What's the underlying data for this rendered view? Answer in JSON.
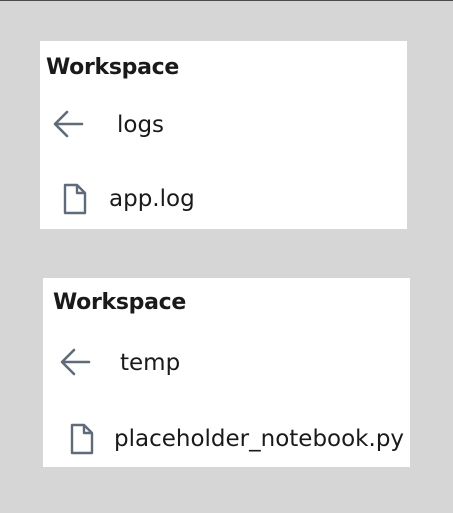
{
  "colors": {
    "background": "#d6d6d6",
    "panel": "#ffffff",
    "text": "#1a1a1a",
    "icon": "#5f6b78"
  },
  "panels": [
    {
      "title": "Workspace",
      "back_icon": "arrow-left-icon",
      "folder": "logs",
      "files": [
        {
          "name": "app.log",
          "icon": "file-icon"
        }
      ]
    },
    {
      "title": "Workspace",
      "back_icon": "arrow-left-icon",
      "folder": "temp",
      "files": [
        {
          "name": "placeholder_notebook.py",
          "icon": "file-icon"
        }
      ]
    }
  ]
}
